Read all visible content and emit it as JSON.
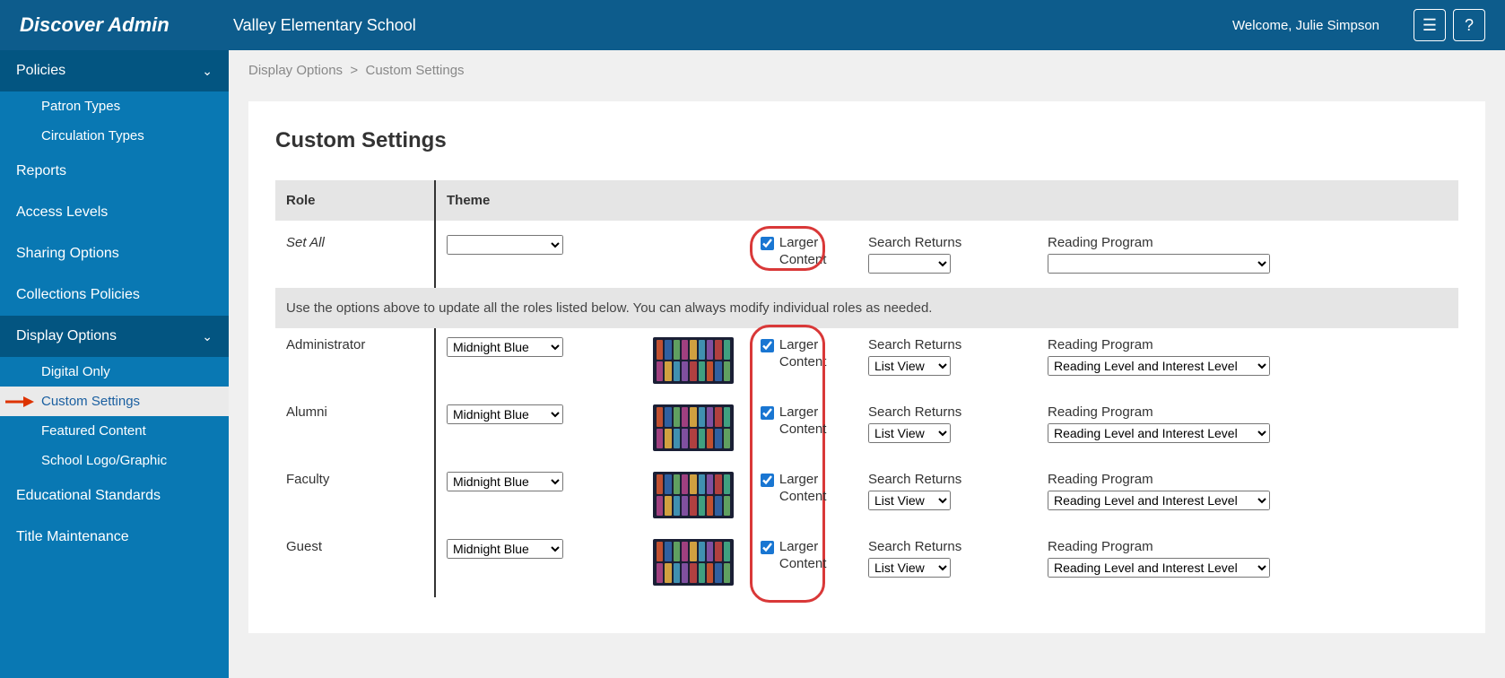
{
  "header": {
    "logo": "Discover Admin",
    "school": "Valley Elementary School",
    "welcome": "Welcome, Julie Simpson"
  },
  "sidebar": {
    "policies": "Policies",
    "patron_types": "Patron Types",
    "circulation_types": "Circulation Types",
    "reports": "Reports",
    "access_levels": "Access Levels",
    "sharing_options": "Sharing Options",
    "collections_policies": "Collections Policies",
    "display_options": "Display Options",
    "digital_only": "Digital Only",
    "custom_settings": "Custom Settings",
    "featured_content": "Featured Content",
    "school_logo": "School Logo/Graphic",
    "educational_standards": "Educational Standards",
    "title_maintenance": "Title Maintenance"
  },
  "breadcrumb": {
    "a": "Display Options",
    "sep": ">",
    "b": "Custom Settings"
  },
  "page": {
    "title": "Custom Settings",
    "col_role": "Role",
    "col_theme": "Theme",
    "set_all": "Set All",
    "larger_content": "Larger Content",
    "search_returns": "Search Returns",
    "reading_program": "Reading Program",
    "helper": "Use the options above to update all the roles listed below. You can always modify individual roles as needed."
  },
  "options": {
    "theme": "Midnight Blue",
    "search": "List View",
    "reading": "Reading Level and Interest Level"
  },
  "roles": [
    "Administrator",
    "Alumni",
    "Faculty",
    "Guest"
  ]
}
